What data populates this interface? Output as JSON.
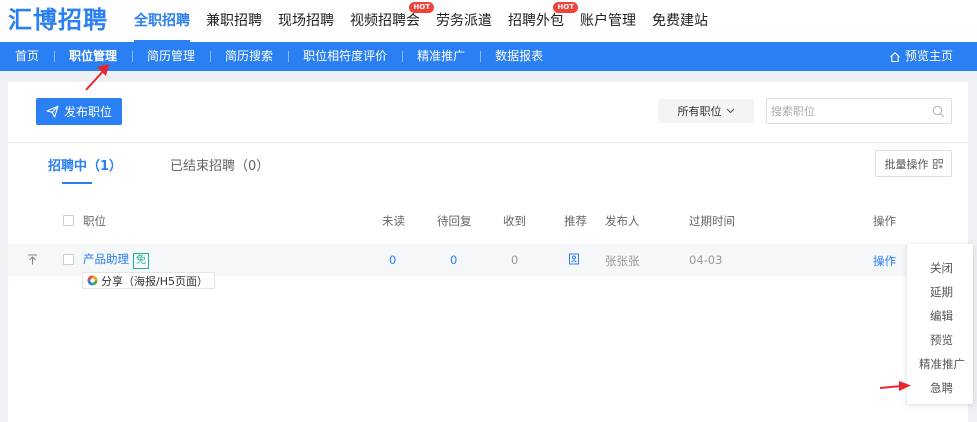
{
  "logo": "汇博招聘",
  "top_nav": [
    {
      "label": "全职招聘",
      "active": true,
      "hot": false
    },
    {
      "label": "兼职招聘",
      "active": false,
      "hot": false
    },
    {
      "label": "现场招聘",
      "active": false,
      "hot": false
    },
    {
      "label": "视频招聘会",
      "active": false,
      "hot": true
    },
    {
      "label": "劳务派遣",
      "active": false,
      "hot": false
    },
    {
      "label": "招聘外包",
      "active": false,
      "hot": true
    },
    {
      "label": "账户管理",
      "active": false,
      "hot": false
    },
    {
      "label": "免费建站",
      "active": false,
      "hot": false
    }
  ],
  "hot_badge": "HOT",
  "sub_nav": [
    {
      "label": "首页",
      "active": false
    },
    {
      "label": "职位管理",
      "active": true
    },
    {
      "label": "简历管理",
      "active": false
    },
    {
      "label": "简历搜索",
      "active": false
    },
    {
      "label": "职位相符度评价",
      "active": false
    },
    {
      "label": "精准推广",
      "active": false
    },
    {
      "label": "数据报表",
      "active": false
    }
  ],
  "preview_home": "预览主页",
  "publish_button": "发布职位",
  "filter_label": "所有职位",
  "search_placeholder": "搜索职位",
  "tabs": {
    "recruiting": "招聘中（1）",
    "ended": "已结束招聘（0）"
  },
  "batch_button": "批量操作",
  "columns": {
    "position": "职位",
    "unread": "未读",
    "pending": "待回复",
    "received": "收到",
    "recommend": "推荐",
    "publisher": "发布人",
    "expire": "过期时间",
    "action": "操作"
  },
  "row": {
    "title": "产品助理",
    "free_badge": "免",
    "unread": "0",
    "pending": "0",
    "received": "0",
    "recommend_icon": "resume-icon",
    "publisher": "张张张",
    "expire": "04-03",
    "action": "操作",
    "share": "分享（海报/H5页面）"
  },
  "action_menu": [
    "关闭",
    "延期",
    "编辑",
    "预览",
    "精准推广",
    "急聘"
  ],
  "colors": {
    "brand": "#2a7ff2",
    "hot": "#f04438",
    "free": "#1fb29d",
    "annotation": "#e8262a"
  }
}
